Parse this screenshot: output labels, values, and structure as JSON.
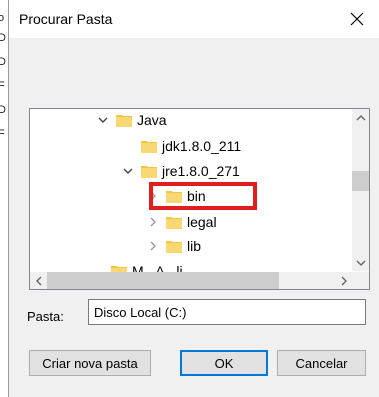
{
  "dialog": {
    "title": "Procurar Pasta",
    "close_icon": "close-icon"
  },
  "background_fragments": [
    "o",
    "D",
    "D",
    "F",
    "D",
    "F"
  ],
  "tree": {
    "nodes": [
      {
        "label": "Java",
        "expanded": true,
        "icon": "folder-icon"
      },
      {
        "label": "jdk1.8.0_211",
        "expanded": false,
        "icon": "folder-icon"
      },
      {
        "label": "jre1.8.0_271",
        "expanded": true,
        "icon": "folder-icon"
      },
      {
        "label": "bin",
        "expanded": false,
        "icon": "folder-icon",
        "highlighted": true
      },
      {
        "label": "legal",
        "expanded": false,
        "icon": "folder-icon"
      },
      {
        "label": "lib",
        "expanded": false,
        "icon": "folder-icon"
      },
      {
        "label": "M...A...li...",
        "expanded": false,
        "icon": "folder-icon",
        "partial": true
      }
    ],
    "highlight_color": "#e01e1e"
  },
  "folder_field": {
    "label": "Pasta:",
    "value": "Disco Local (C:)"
  },
  "buttons": {
    "new_folder": "Criar nova pasta",
    "ok": "OK",
    "cancel": "Cancelar"
  },
  "colors": {
    "folder": "#f4c542",
    "accent": "#0078d7"
  }
}
